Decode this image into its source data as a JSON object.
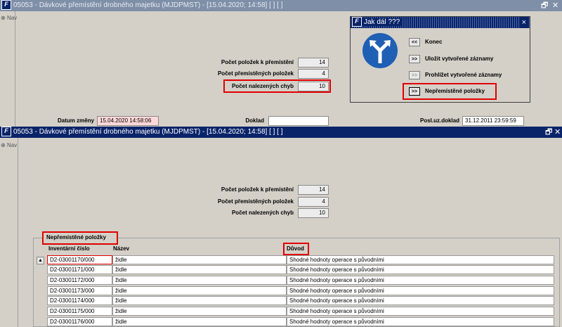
{
  "back_window": {
    "title": "05053 - Dávkové přemístění drobného majetku (MJDPMST) - [15.04.2020; 14:58]  [ ]  [ ]",
    "nav_label": "Nav",
    "counts": [
      {
        "label": "Počet položek k přemístění",
        "value": "14"
      },
      {
        "label": "Počet přemístěných položek",
        "value": "4"
      },
      {
        "label": "Počet nalezených chyb",
        "value": "10"
      }
    ],
    "datum_label": "Datum změny",
    "datum_value": "15.04.2020 14:58:06",
    "doklad_label": "Doklad",
    "doklad_value": "",
    "posl_label": "Posl.uz.doklad",
    "posl_value": "31.12.2011 23:59:59"
  },
  "dialog": {
    "title": "Jak dál ???",
    "close": "×",
    "options": [
      {
        "button": "<<",
        "label": "Konec",
        "enabled": true
      },
      {
        "button": ">>",
        "label": "Uložit vytvořené záznamy",
        "enabled": true
      },
      {
        "button": ">>",
        "label": "Prohlížet vytvořené záznamy",
        "enabled": false
      },
      {
        "button": ">>",
        "label": "Nepřemístěné položky",
        "enabled": true
      }
    ]
  },
  "front_window": {
    "title": "05053 - Dávkové přemístění drobného majetku (MJDPMST) - [15.04.2020; 14:58]  [ ]  [ ]",
    "nav_label": "Nav",
    "counts": [
      {
        "label": "Počet položek k přemístění",
        "value": "14"
      },
      {
        "label": "Počet přemístěných položek",
        "value": "4"
      },
      {
        "label": "Počet nalezených chyb",
        "value": "10"
      }
    ],
    "section_title": "Nepřemístěné položky",
    "columns": {
      "inv": "Inventární číslo",
      "name": "Název",
      "reason": "Důvod"
    },
    "rows": [
      {
        "inv": "D2-03001170/000",
        "name": "židle",
        "reason": "Shodné hodnoty operace s původními"
      },
      {
        "inv": "D2-03001171/000",
        "name": "židle",
        "reason": "Shodné hodnoty operace s původními"
      },
      {
        "inv": "D2-03001172/000",
        "name": "židle",
        "reason": "Shodné hodnoty operace s původními"
      },
      {
        "inv": "D2-03001173/000",
        "name": "židle",
        "reason": "Shodné hodnoty operace s původními"
      },
      {
        "inv": "D2-03001174/000",
        "name": "židle",
        "reason": "Shodné hodnoty operace s původními"
      },
      {
        "inv": "D2-03001175/000",
        "name": "židle",
        "reason": "Shodné hodnoty operace s původními"
      },
      {
        "inv": "D2-03001176/000",
        "name": "židle",
        "reason": "Shodné hodnoty operace s původními"
      }
    ]
  },
  "colors": {
    "title_active": "#0a246a",
    "title_inactive": "#7f8fa8",
    "highlight_red": "#e00000",
    "field_error": "#ffd8d8"
  }
}
